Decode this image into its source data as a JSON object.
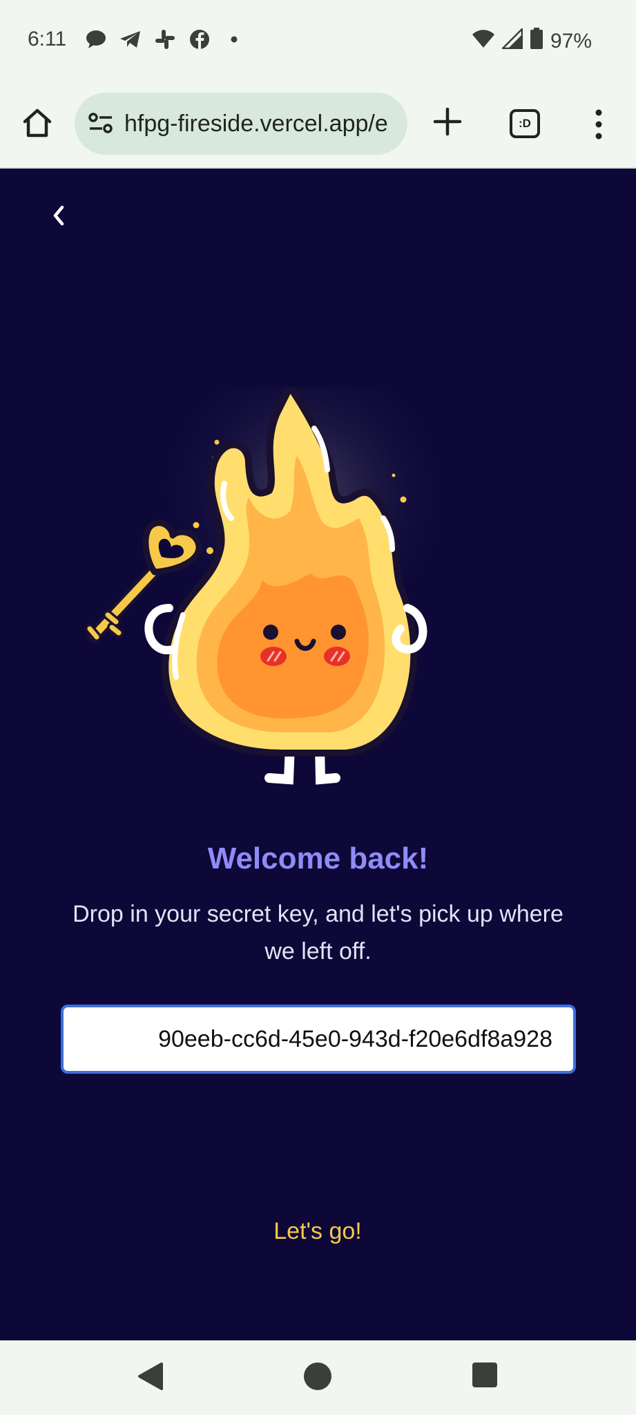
{
  "status_bar": {
    "time": "6:11",
    "battery": "97%",
    "notification_icons": [
      "chat-bubble-icon",
      "telegram-icon",
      "slack-icon",
      "facebook-icon",
      "dot-icon"
    ]
  },
  "browser": {
    "url": "hfpg-fireside.vercel.app/e",
    "tab_switcher_label": ":D"
  },
  "page": {
    "title": "Welcome back!",
    "subtitle": "Drop in your secret key, and let's pick up where we left off.",
    "key_input_value": "90eeb-cc6d-45e0-943d-f20e6df8a928",
    "submit_label": "Let's go!"
  },
  "colors": {
    "background": "#0d0838",
    "title": "#8f8cf7",
    "button_text": "#f7c948",
    "input_border": "#3b6fde"
  }
}
